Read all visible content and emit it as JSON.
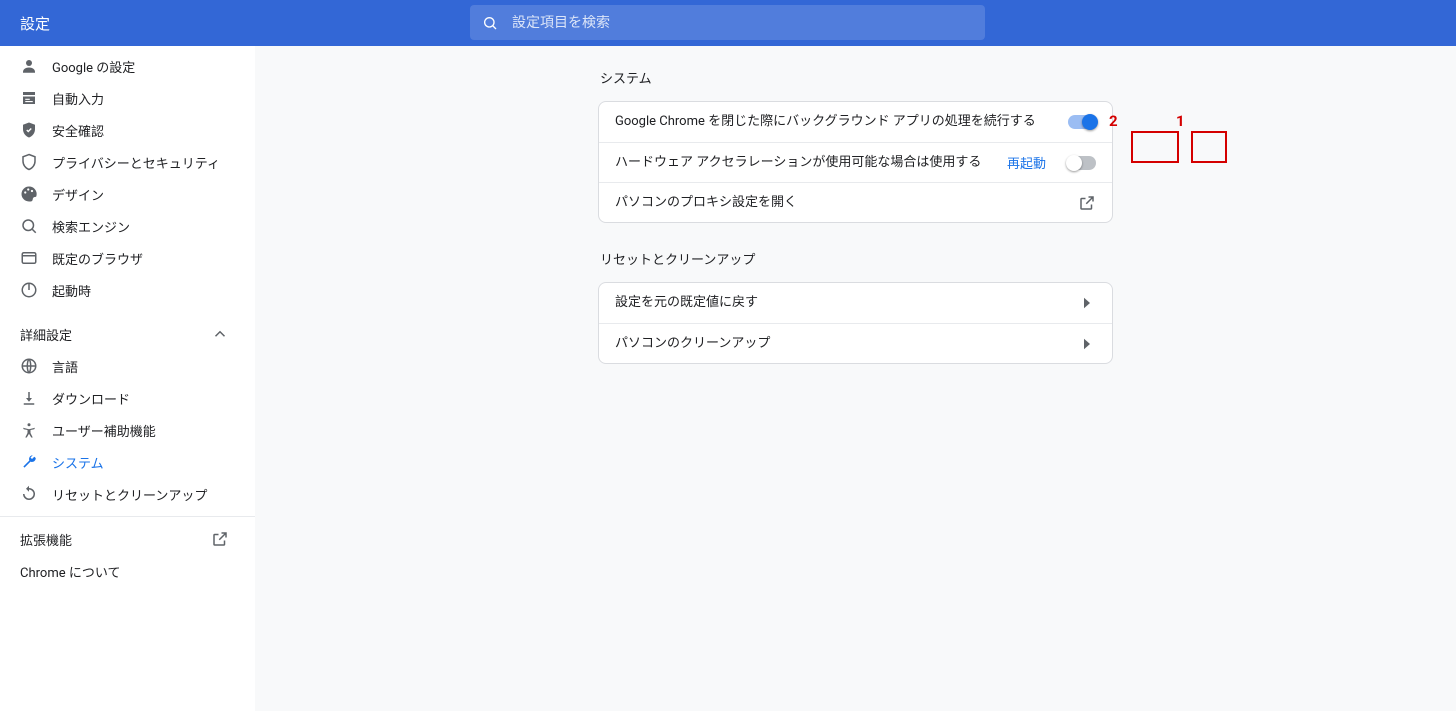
{
  "header": {
    "title": "設定",
    "search_placeholder": "設定項目を検索"
  },
  "sidebar": {
    "items": [
      {
        "icon": "person",
        "label": "Google の設定"
      },
      {
        "icon": "autofill",
        "label": "自動入力"
      },
      {
        "icon": "shield",
        "label": "安全確認"
      },
      {
        "icon": "shield-outline",
        "label": "プライバシーとセキュリティ"
      },
      {
        "icon": "palette",
        "label": "デザイン"
      },
      {
        "icon": "search",
        "label": "検索エンジン"
      },
      {
        "icon": "browser",
        "label": "既定のブラウザ"
      },
      {
        "icon": "power",
        "label": "起動時"
      }
    ],
    "advanced_label": "詳細設定",
    "advanced_items": [
      {
        "icon": "globe",
        "label": "言語"
      },
      {
        "icon": "download",
        "label": "ダウンロード"
      },
      {
        "icon": "accessibility",
        "label": "ユーザー補助機能"
      },
      {
        "icon": "wrench",
        "label": "システム",
        "active": true
      },
      {
        "icon": "reset",
        "label": "リセットとクリーンアップ"
      }
    ],
    "extensions_label": "拡張機能",
    "about_label": "Chrome について"
  },
  "main": {
    "system": {
      "title": "システム",
      "rows": [
        {
          "label": "Google Chrome を閉じた際にバックグラウンド アプリの処理を続行する",
          "toggle": "on"
        },
        {
          "label": "ハードウェア アクセラレーションが使用可能な場合は使用する",
          "link": "再起動",
          "toggle": "off"
        },
        {
          "label": "パソコンのプロキシ設定を開く",
          "trail": "external"
        }
      ]
    },
    "reset": {
      "title": "リセットとクリーンアップ",
      "rows": [
        {
          "label": "設定を元の既定値に戻す",
          "trail": "arrow"
        },
        {
          "label": "パソコンのクリーンアップ",
          "trail": "arrow"
        }
      ]
    }
  },
  "annotations": {
    "label1": "1",
    "label2": "2"
  }
}
